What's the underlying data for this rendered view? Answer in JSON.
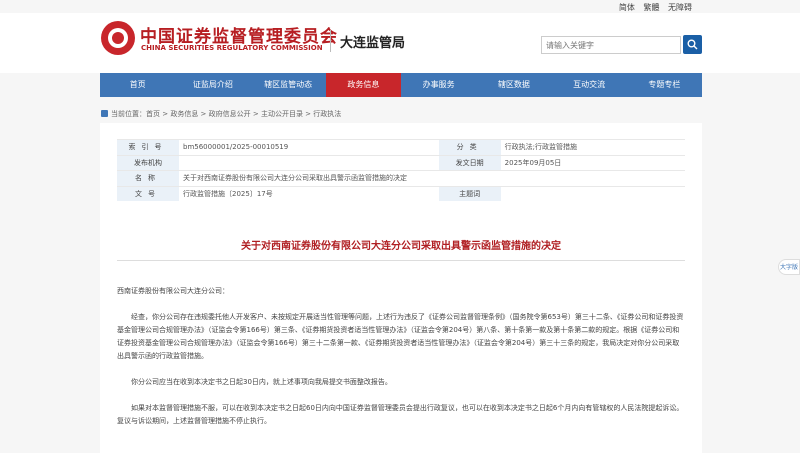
{
  "toplinks": [
    "简体",
    "繁體",
    "无障碍"
  ],
  "header": {
    "org_cn": "中国证券监督管理委员会",
    "org_en": "CHINA SECURITIES REGULATORY COMMISSION",
    "bureau": "大连监管局",
    "search_placeholder": "请输入关键字"
  },
  "nav": [
    "首页",
    "证监局介绍",
    "辖区监管动态",
    "政务信息",
    "办事服务",
    "辖区数据",
    "互动交流",
    "专题专栏"
  ],
  "active_nav": "政务信息",
  "breadcrumb": "当前位置：首页 > 政务信息 > 政府信息公开 > 主动公开目录 > 行政执法",
  "meta": {
    "index_label": "索引号",
    "index_value": "bm56000001/2025-00010519",
    "category_label": "分类",
    "category_value": "行政执法;行政监管措施",
    "issuer_label": "发布机构",
    "issuer_value": "",
    "date_label": "发文日期",
    "date_value": "2025年09月05日",
    "name_label": "名称",
    "name_value": "关于对西南证券股份有限公司大连分公司采取出具警示函监管措施的决定",
    "docno_label": "文号",
    "docno_value": "行政监管措施〔2025〕17号",
    "topic_label": "主题词",
    "topic_value": ""
  },
  "title": "关于对西南证券股份有限公司大连分公司采取出具警示函监管措施的决定",
  "body": {
    "addressee": "西南证券股份有限公司大连分公司：",
    "p1": "经查，你分公司存在违规委托他人开发客户、未按规定开展适当性管理等问题，上述行为违反了《证券公司监督管理条例》（国务院令第653号）第三十二条、《证券公司和证券投资基金管理公司合规管理办法》（证监会令第166号）第三条、《证券期货投资者适当性管理办法》（证监会令第204号）第八条、第十条第一款及第十条第二款的规定。根据《证券公司和证券投资基金管理公司合规管理办法》（证监会令第166号）第三十二条第一款、《证券期货投资者适当性管理办法》（证监会令第204号）第三十三条的规定，我局决定对你分公司采取出具警示函的行政监管措施。",
    "p2": "你分公司应当在收到本决定书之日起30日内，就上述事项向我局提交书面整改报告。",
    "p3": "如果对本监督管理措施不服，可以在收到本决定书之日起60日内向中国证券监督管理委员会提出行政复议，也可以在收到本决定书之日起6个月内向有管辖权的人民法院提起诉讼。复议与诉讼期间，上述监督管理措施不停止执行。"
  },
  "float_widget": "大字版"
}
